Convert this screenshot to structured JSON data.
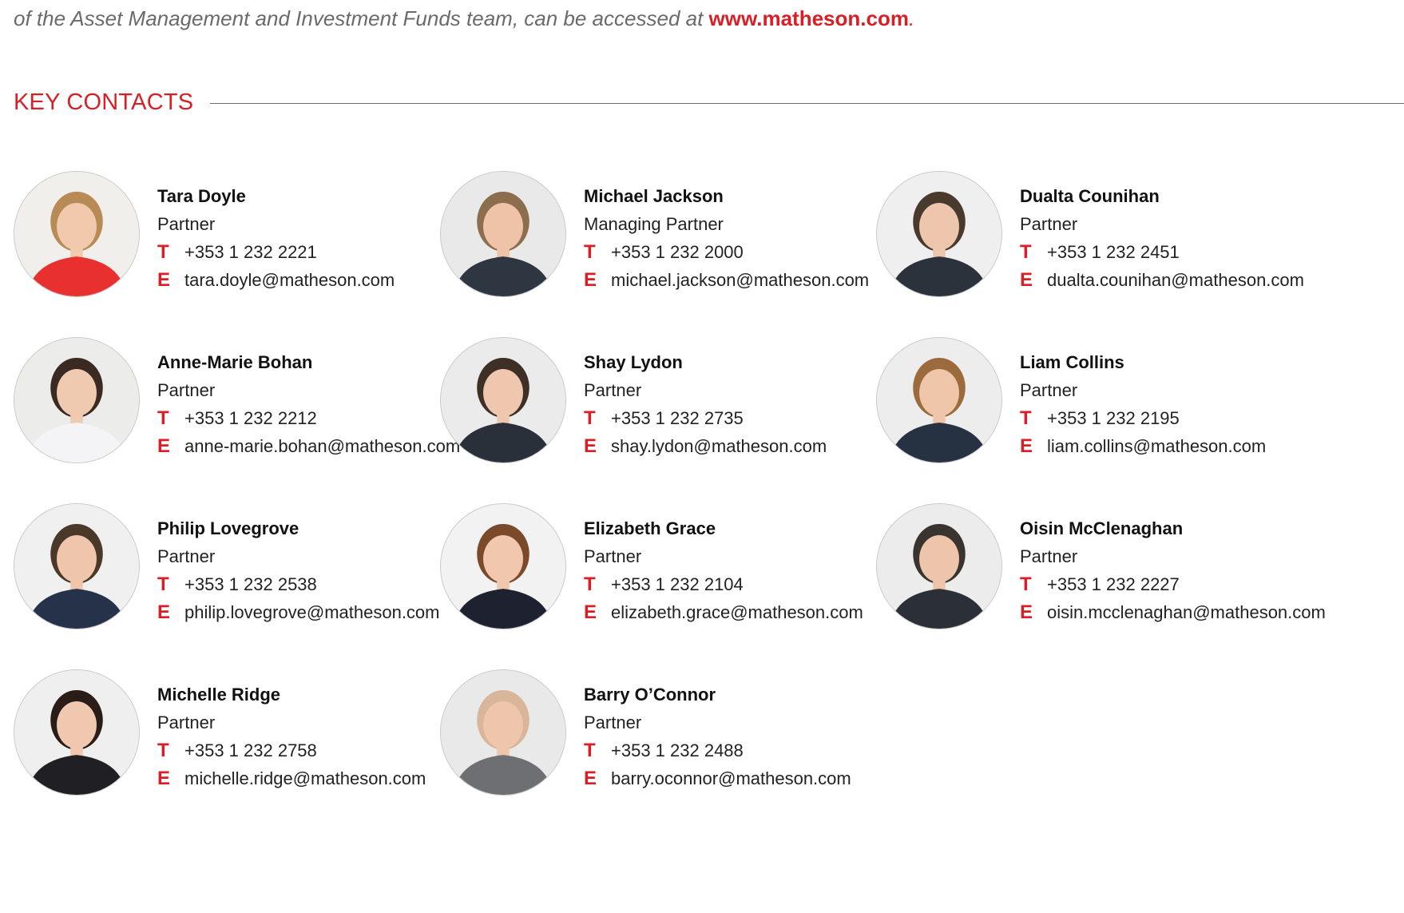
{
  "intro": {
    "text": "of the Asset Management and Investment Funds team, can be accessed at",
    "link": "www.matheson.com",
    "trail": "."
  },
  "section": {
    "title": "KEY CONTACTS"
  },
  "labels": {
    "phone": "T",
    "email": "E"
  },
  "colors": {
    "accent": "#d91f26",
    "rule": "#6d6d6d"
  },
  "contacts": [
    {
      "name": "Tara Doyle",
      "role": "Partner",
      "phone": "+353 1 232 2221",
      "email": "tara.doyle@matheson.com",
      "top": "#f1efec",
      "hair": "#b78a56",
      "skin": "#f1c9ad",
      "shirt": "#e8302f"
    },
    {
      "name": "Michael Jackson",
      "role": "Managing Partner",
      "phone": "+353 1 232 2000",
      "email": "michael.jackson@matheson.com",
      "top": "#e9e9e9",
      "hair": "#8c6d4d",
      "skin": "#eec3a8",
      "shirt": "#2e3642"
    },
    {
      "name": "Dualta Counihan",
      "role": "Partner",
      "phone": "+353 1 232 2451",
      "email": "dualta.counihan@matheson.com",
      "top": "#efefef",
      "hair": "#4a3a2d",
      "skin": "#eec5ad",
      "shirt": "#2b323b"
    },
    {
      "name": "Anne-Marie Bohan",
      "role": "Partner",
      "phone": "+353 1 232 2212",
      "email": "anne-marie.bohan@matheson.com",
      "top": "#ececeb",
      "hair": "#3b2a21",
      "skin": "#f0c9b1",
      "shirt": "#f4f4f6"
    },
    {
      "name": "Shay Lydon",
      "role": "Partner",
      "phone": "+353 1 232 2735",
      "email": "shay.lydon@matheson.com",
      "top": "#ebebeb",
      "hair": "#3e3026",
      "skin": "#efc7ae",
      "shirt": "#2a3039"
    },
    {
      "name": "Liam Collins",
      "role": "Partner",
      "phone": "+353 1 232 2195",
      "email": "liam.collins@matheson.com",
      "top": "#ededed",
      "hair": "#9b6a3d",
      "skin": "#f0c6ab",
      "shirt": "#263141"
    },
    {
      "name": "Philip Lovegrove",
      "role": "Partner",
      "phone": "+353 1 232 2538",
      "email": "philip.lovegrove@matheson.com",
      "top": "#f0f0f0",
      "hair": "#4b3828",
      "skin": "#efc6ac",
      "shirt": "#25324a"
    },
    {
      "name": "Elizabeth Grace",
      "role": "Partner",
      "phone": "+353 1 232 2104",
      "email": "elizabeth.grace@matheson.com",
      "top": "#f2f2f2",
      "hair": "#7a4a2a",
      "skin": "#f1c8ae",
      "shirt": "#1e2230"
    },
    {
      "name": "Oisin McClenaghan",
      "role": "Partner",
      "phone": "+353 1 232 2227",
      "email": "oisin.mcclenaghan@matheson.com",
      "top": "#ececec",
      "hair": "#3a3430",
      "skin": "#eec4aa",
      "shirt": "#2b3038"
    },
    {
      "name": "Michelle Ridge",
      "role": "Partner",
      "phone": "+353 1 232 2758",
      "email": "michelle.ridge@matheson.com",
      "top": "#efefef",
      "hair": "#2a1d17",
      "skin": "#f0c8b0",
      "shirt": "#1f1f24"
    },
    {
      "name": "Barry O’Connor",
      "role": "Partner",
      "phone": "+353 1 232 2488",
      "email": "barry.oconnor@matheson.com",
      "top": "#e9e9e9",
      "hair": "#d9b59a",
      "skin": "#efc5ab",
      "shirt": "#6e6f72"
    }
  ]
}
